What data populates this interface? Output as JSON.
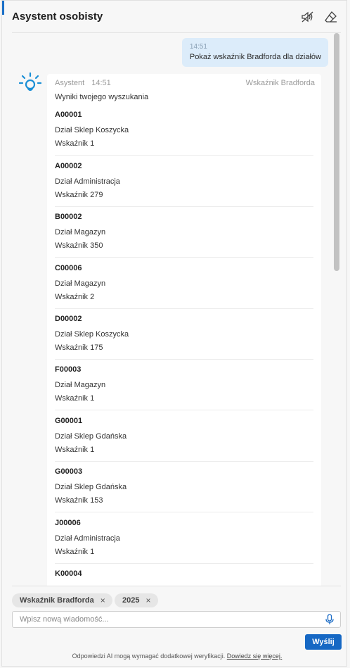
{
  "header": {
    "title": "Asystent osobisty",
    "icons": [
      "speaker-muted-icon",
      "eraser-icon"
    ]
  },
  "user_message": {
    "time": "14:51",
    "text": "Pokaż wskaźnik Bradforda dla działów"
  },
  "assistant_message": {
    "sender": "Asystent",
    "time": "14:51",
    "tag": "Wskaźnik Bradforda",
    "intro": "Wyniki twojego wyszukania",
    "results": [
      {
        "code": "A00001",
        "dept": "Dział Sklep Koszycka",
        "value": "Wskaźnik 1"
      },
      {
        "code": "A00002",
        "dept": "Dział Administracja",
        "value": "Wskaźnik 279"
      },
      {
        "code": "B00002",
        "dept": "Dział Magazyn",
        "value": "Wskaźnik 350"
      },
      {
        "code": "C00006",
        "dept": "Dział Magazyn",
        "value": "Wskaźnik 2"
      },
      {
        "code": "D00002",
        "dept": "Dział Sklep Koszycka",
        "value": "Wskaźnik 175"
      },
      {
        "code": "F00003",
        "dept": "Dział Magazyn",
        "value": "Wskaźnik 1"
      },
      {
        "code": "G00001",
        "dept": "Dział Sklep Gdańska",
        "value": "Wskaźnik 1"
      },
      {
        "code": "G00003",
        "dept": "Dział Sklep Gdańska",
        "value": "Wskaźnik 153"
      },
      {
        "code": "J00006",
        "dept": "Dział Administracja",
        "value": "Wskaźnik 1"
      },
      {
        "code": "K00004",
        "dept": "",
        "value": ""
      }
    ]
  },
  "filters": [
    {
      "label": "Wskaźnik Bradforda",
      "remove": "×"
    },
    {
      "label": "2025",
      "remove": "×"
    }
  ],
  "composer": {
    "placeholder": "Wpisz nową wiadomość...",
    "value": "",
    "send_label": "Wyślij"
  },
  "footer": {
    "disclaimer": "Odpowiedzi AI mogą wymagać dodatkowej weryfikacji.",
    "link": "Dowiedz się więcej."
  },
  "colors": {
    "accent": "#1668c4",
    "user_bubble": "#dcecfa",
    "avatar": "#1a8fd6"
  }
}
